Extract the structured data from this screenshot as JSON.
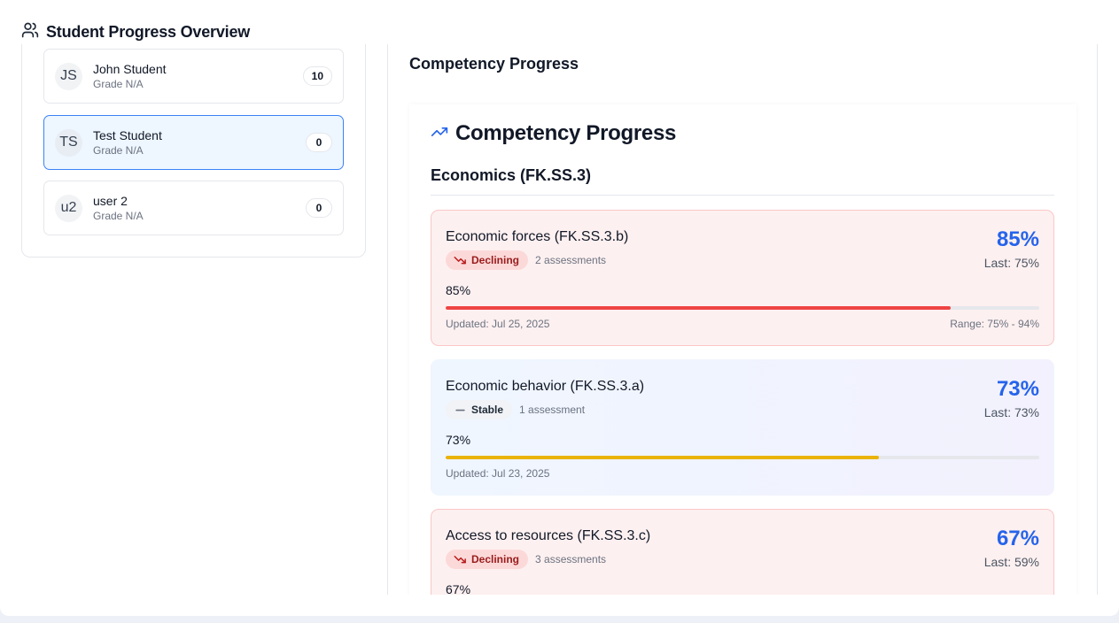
{
  "header": {
    "title": "Student Progress Overview",
    "icon": "users-icon"
  },
  "students": [
    {
      "initials": "JS",
      "name": "John Student",
      "grade": "Grade N/A",
      "count": "10",
      "selected": false
    },
    {
      "initials": "TS",
      "name": "Test Student",
      "grade": "Grade N/A",
      "count": "0",
      "selected": true
    },
    {
      "initials": "u2",
      "name": "user 2",
      "grade": "Grade N/A",
      "count": "0",
      "selected": false
    }
  ],
  "right": {
    "section_title": "Competency Progress",
    "card_title": "Competency Progress",
    "card_icon": "trending-up-icon",
    "domain_title": "Economics (FK.SS.3)"
  },
  "competencies": [
    {
      "name": "Economic forces (FK.SS.3.b)",
      "status": "Declining",
      "assessments": "2 assessments",
      "percent": "85%",
      "last": "Last: 75%",
      "current": "85%",
      "progress": 85,
      "updated": "Updated: Jul 25, 2025",
      "range": "Range: 75% - 94%",
      "bar_color": "#ef4444"
    },
    {
      "name": "Economic behavior (FK.SS.3.a)",
      "status": "Stable",
      "assessments": "1 assessment",
      "percent": "73%",
      "last": "Last: 73%",
      "current": "73%",
      "progress": 73,
      "updated": "Updated: Jul 23, 2025",
      "range": "",
      "bar_color": "#eab308"
    },
    {
      "name": "Access to resources (FK.SS.3.c)",
      "status": "Declining",
      "assessments": "3 assessments",
      "percent": "67%",
      "last": "Last: 59%",
      "current": "67%",
      "progress": 67,
      "updated": "",
      "range": "",
      "bar_color": "#ef4444"
    }
  ],
  "colors": {
    "accent": "#2563eb",
    "declining": "#991b1b",
    "selected_border": "#3b82f6"
  }
}
